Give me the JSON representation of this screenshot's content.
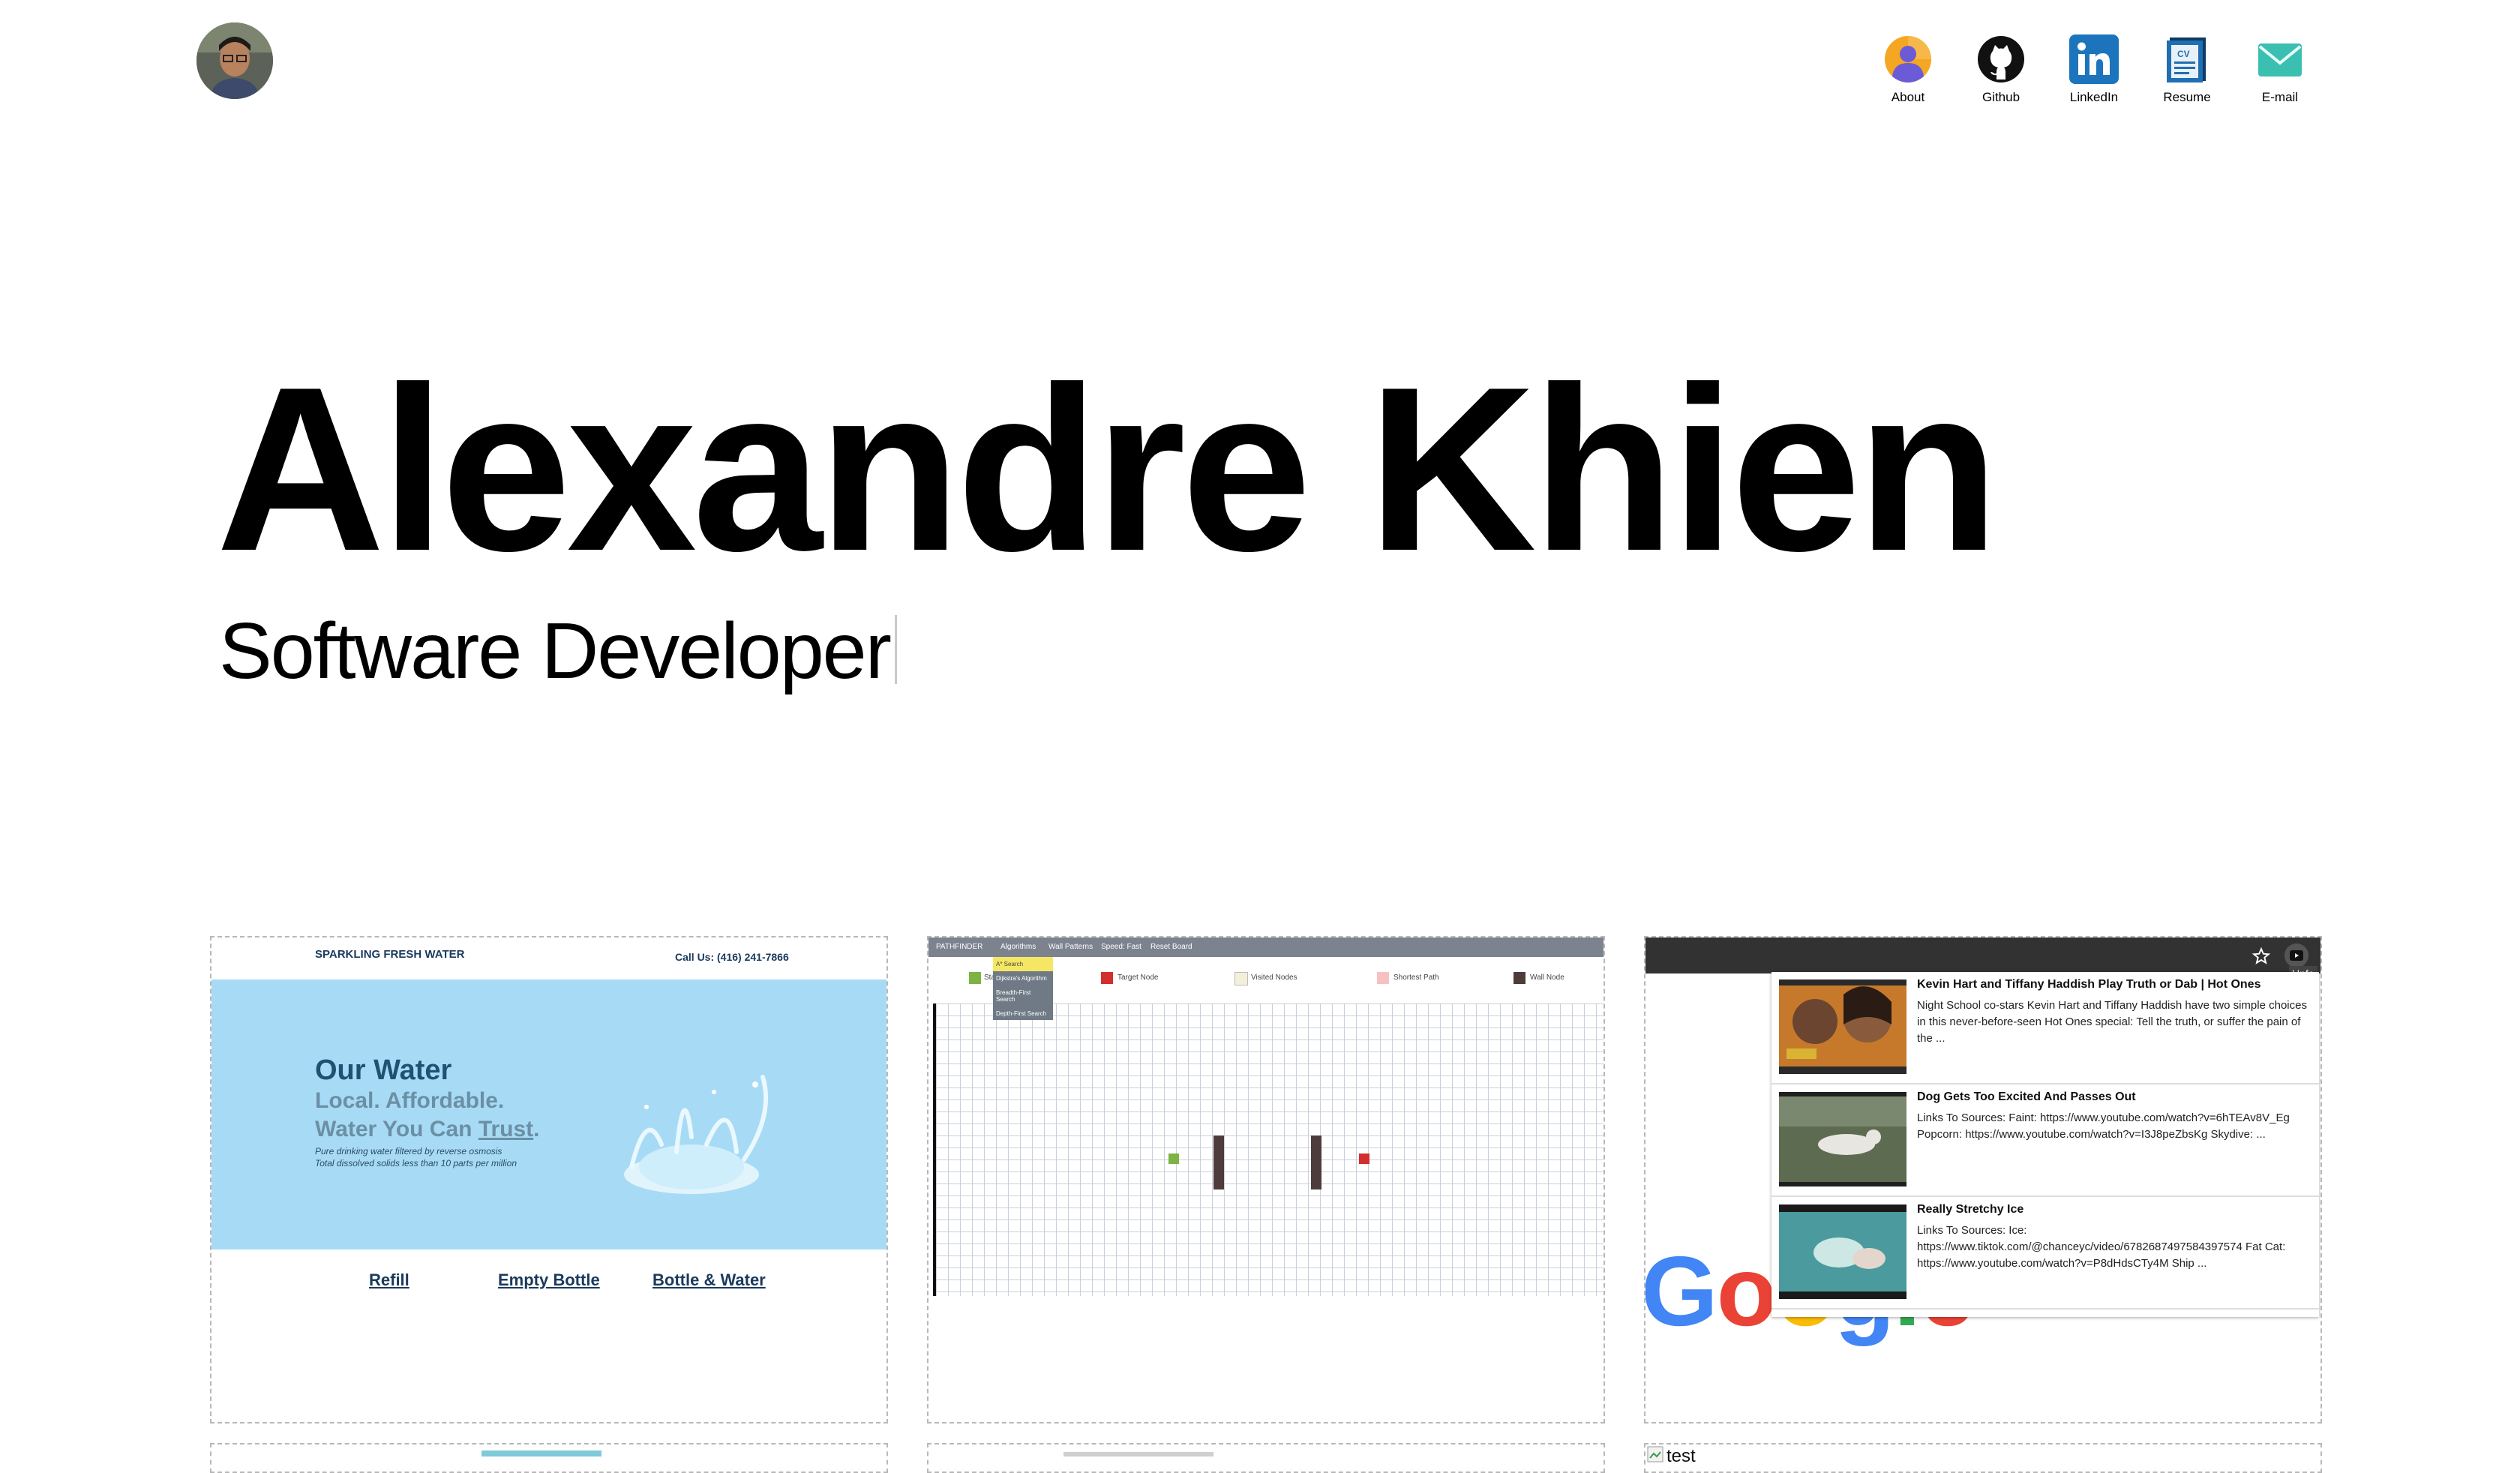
{
  "header": {
    "nav": [
      {
        "label": "About",
        "icon": "about-icon"
      },
      {
        "label": "Github",
        "icon": "github-icon"
      },
      {
        "label": "LinkedIn",
        "icon": "linkedin-icon"
      },
      {
        "label": "Resume",
        "icon": "resume-icon"
      },
      {
        "label": "E-mail",
        "icon": "email-icon"
      }
    ]
  },
  "hero": {
    "name": "Alexandre Khien",
    "role": "Software Developer"
  },
  "projects": {
    "water": {
      "brand": "SPARKLING FRESH WATER",
      "call": "Call Us: (416) 241-7866",
      "headline": "Our Water",
      "sub1": "Local. Affordable.",
      "sub2_prefix": "Water You Can ",
      "sub2_link": "Trust",
      "sub2_suffix": ".",
      "small1": "Pure drinking water filtered by reverse osmosis",
      "small2": "Total dissolved solids less than 10 parts per million",
      "links": [
        "Refill",
        "Empty Bottle",
        "Bottle & Water"
      ]
    },
    "pathfinder": {
      "menu": [
        "PATHFINDER",
        "Algorithms",
        "Wall Patterns",
        "Speed: Fast",
        "Reset Board"
      ],
      "dropdown": [
        "A* Search",
        "Dijkstra's Algorithm",
        "Breadth-First Search",
        "Depth-First Search"
      ],
      "legend": [
        "Start Node",
        "Target Node",
        "Visited Nodes",
        "Shortest Path",
        "Wall Node"
      ]
    },
    "extension": {
      "tooltip": "Unfo",
      "items": [
        {
          "title": "Kevin Hart and Tiffany Haddish Play Truth or Dab | Hot Ones",
          "desc": "Night School co-stars Kevin Hart and Tiffany Haddish have two simple choices in this never-before-seen Hot Ones special: Tell the truth, or suffer the pain of the ..."
        },
        {
          "title": "Dog Gets Too Excited And Passes Out",
          "desc": "Links To Sources: Faint: https://www.youtube.com/watch?v=6hTEAv8V_Eg Popcorn: https://www.youtube.com/watch?v=I3J8peZbsKg Skydive: ..."
        },
        {
          "title": "Really Stretchy Ice",
          "desc": "Links To Sources: Ice: https://www.tiktok.com/@chanceyc/video/6782687497584397574 Fat Cat: https://www.youtube.com/watch?v=P8dHdsCTy4M Ship ..."
        }
      ],
      "google": "Google"
    },
    "row2": {
      "broken_alt": "test"
    }
  },
  "colors": {
    "water_hero": "#a7dbf5",
    "water_text": "#1f5272",
    "pathfinder_bar": "#7c838e",
    "start_node": "#7cb342",
    "target_node": "#d32f2f",
    "wall_node": "#4e3b3b"
  }
}
